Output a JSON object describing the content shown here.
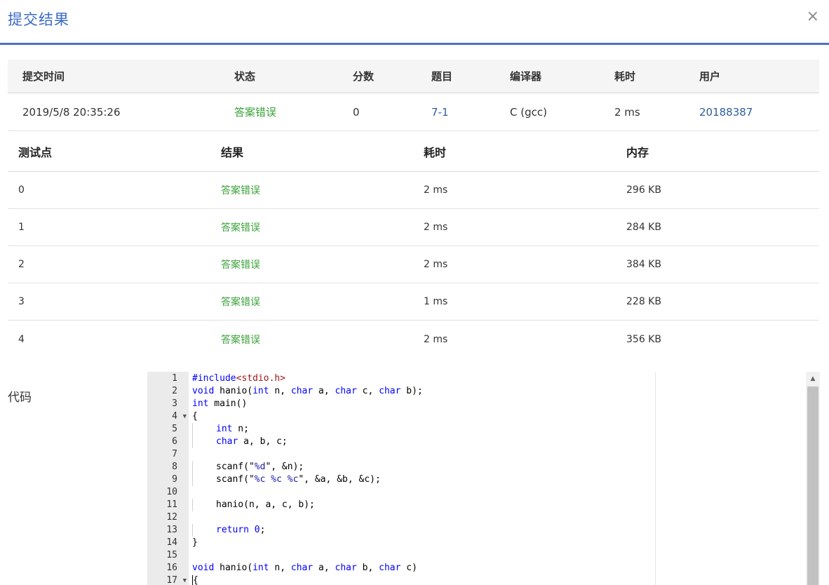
{
  "dialog": {
    "title": "提交结果",
    "close_label": "×"
  },
  "summary": {
    "headers": [
      "提交时间",
      "状态",
      "分数",
      "题目",
      "编译器",
      "耗时",
      "用户"
    ],
    "row": {
      "time": "2019/5/8 20:35:26",
      "status": "答案错误",
      "score": "0",
      "problem": "7-1",
      "compiler": "C (gcc)",
      "elapsed": "2 ms",
      "user": "20188387"
    }
  },
  "tests": {
    "headers": [
      "测试点",
      "结果",
      "耗时",
      "内存"
    ],
    "rows": [
      {
        "id": "0",
        "result": "答案错误",
        "time": "2 ms",
        "memory": "296 KB"
      },
      {
        "id": "1",
        "result": "答案错误",
        "time": "2 ms",
        "memory": "284 KB"
      },
      {
        "id": "2",
        "result": "答案错误",
        "time": "2 ms",
        "memory": "384 KB"
      },
      {
        "id": "3",
        "result": "答案错误",
        "time": "1 ms",
        "memory": "228 KB"
      },
      {
        "id": "4",
        "result": "答案错误",
        "time": "2 ms",
        "memory": "356 KB"
      }
    ]
  },
  "code": {
    "label": "代码",
    "line_numbers": [
      "1",
      "2",
      "3",
      "4",
      "5",
      "6",
      "7",
      "8",
      "9",
      "10",
      "11",
      "12",
      "13",
      "14",
      "15",
      "16",
      "17"
    ],
    "lines": [
      "#include<stdio.h>",
      "void hanio(int n, char a, char c, char b);",
      "int main()",
      "{",
      "    int n;",
      "    char a, b, c;",
      "",
      "    scanf(\"%d\", &n);",
      "    scanf(\"%c %c %c\", &a, &b, &c);",
      "",
      "    hanio(n, a, c, b);",
      "",
      "    return 0;",
      "}",
      "",
      "void hanio(int n, char a, char b, char c)",
      "{"
    ],
    "fold_markers": [
      "▼",
      "▼"
    ]
  },
  "colors": {
    "accent": "#3b6bc7",
    "status_green": "#3aa13a",
    "link": "#2f5e9a"
  },
  "icons": {
    "close": "close-icon",
    "fold": "fold-arrow-icon",
    "scroll_up": "scroll-up-icon"
  }
}
